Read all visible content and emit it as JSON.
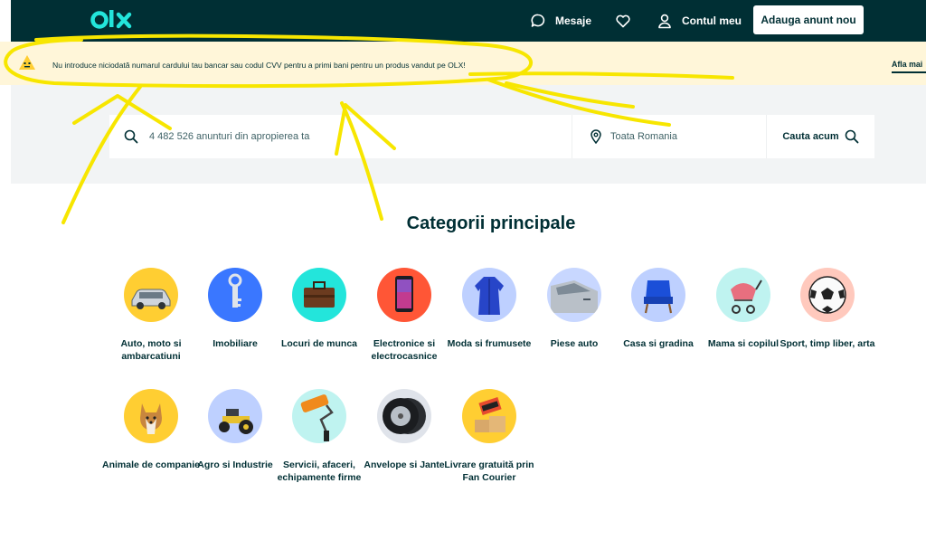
{
  "header": {
    "logo_text": "olx",
    "messages_label": "Mesaje",
    "account_label": "Contul meu",
    "post_ad_label": "Adauga anunt nou"
  },
  "warning": {
    "text": "Nu introduce niciodată numarul cardului tau bancar sau codul CVV pentru a primi bani pentru un produs vandut pe OLX!",
    "link_text": "Afla mai"
  },
  "search": {
    "placeholder": "4 482 526 anunturi din apropierea ta",
    "location": "Toata Romania",
    "button_label": "Cauta acum"
  },
  "categories_title": "Categorii principale",
  "categories": [
    {
      "label": "Auto, moto si ambarcatiuni",
      "color": "#ffce32"
    },
    {
      "label": "Imobiliare",
      "color": "#3a77ff"
    },
    {
      "label": "Locuri de munca",
      "color": "#23e5db"
    },
    {
      "label": "Electronice si electrocasnice",
      "color": "#ff5636"
    },
    {
      "label": "Moda si frumusete",
      "color": "#bed0ff"
    },
    {
      "label": "Piese auto",
      "color": "#c8d7ff"
    },
    {
      "label": "Casa si gradina",
      "color": "#bed0ff"
    },
    {
      "label": "Mama si copilul",
      "color": "#bff3f0"
    },
    {
      "label": "Sport, timp liber, arta",
      "color": "#ffc9bd"
    },
    {
      "label": "Animale de companie",
      "color": "#ffce32"
    },
    {
      "label": "Agro si Industrie",
      "color": "#bed0ff"
    },
    {
      "label": "Servicii, afaceri, echipamente firme",
      "color": "#bff3f0"
    },
    {
      "label": "Anvelope si Jante",
      "color": "#dfe3ea"
    },
    {
      "label": "Livrare gratuită prin Fan Courier",
      "color": "#ffce32"
    }
  ]
}
